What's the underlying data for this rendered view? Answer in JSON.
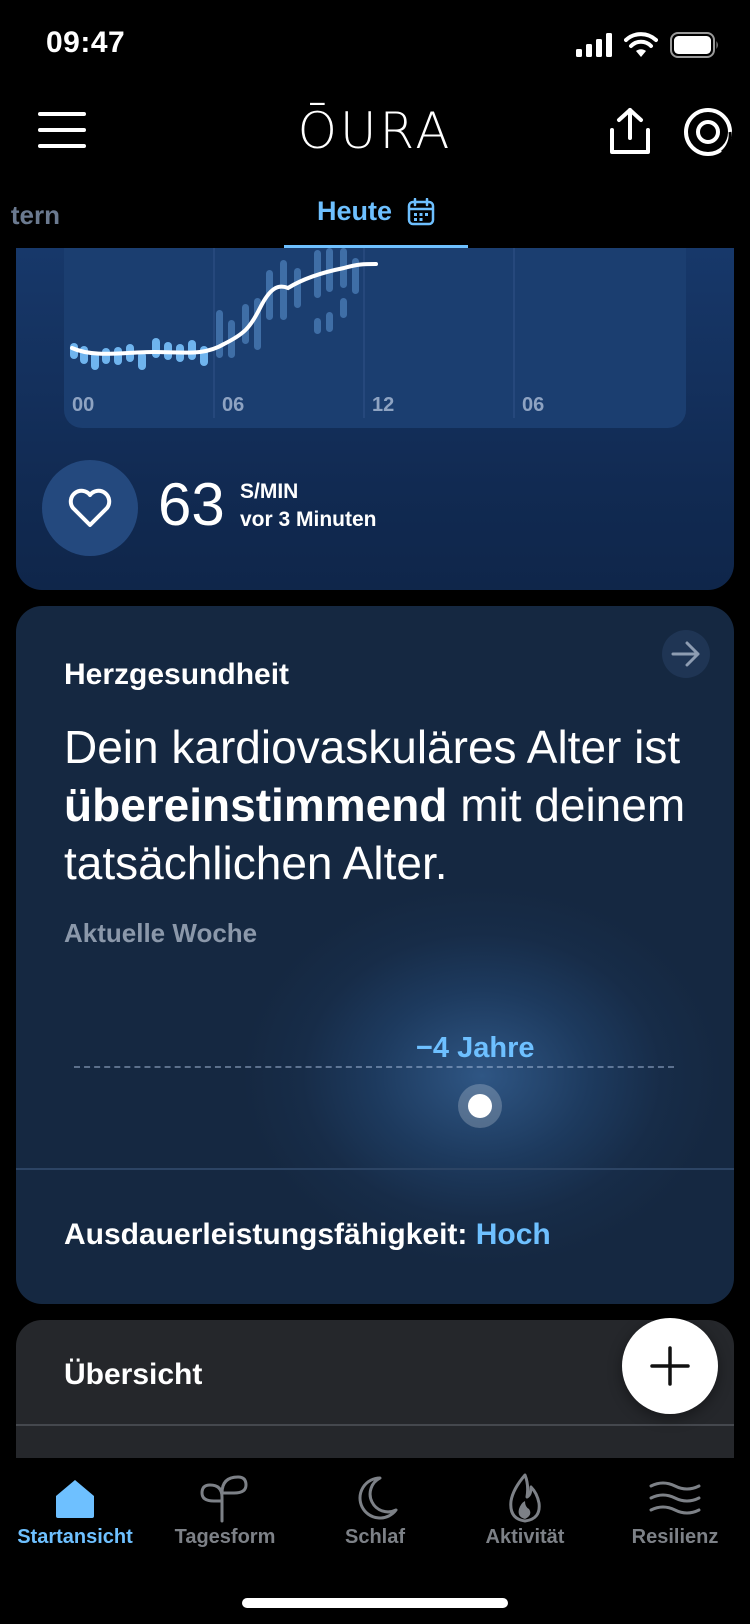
{
  "status_bar": {
    "time": "09:47"
  },
  "header": {
    "brand": "ŌURA"
  },
  "date_tabs": {
    "previous_partial": "tern",
    "today": "Heute"
  },
  "heart_rate": {
    "value": "63",
    "unit": "S/MIN",
    "updated": "vor 3 Minuten",
    "chart_ticks": [
      "00",
      "06",
      "12",
      "06"
    ]
  },
  "heart_health": {
    "title": "Herzgesundheit",
    "headline_before": "Dein kardiovaskuläres Alter ist ",
    "headline_bold": "übereinstimmend",
    "headline_after": " mit deinem tatsächlichen Alter.",
    "period": "Aktuelle Woche",
    "age_offset": "−4 Jahre",
    "capacity_label": "Ausdauerleistungsfähigkeit: ",
    "capacity_value": "Hoch"
  },
  "overview": {
    "title": "Übersicht"
  },
  "bottom_nav": {
    "items": [
      {
        "label": "Startansicht",
        "icon": "home-icon",
        "active": true
      },
      {
        "label": "Tagesform",
        "icon": "sprout-icon",
        "active": false
      },
      {
        "label": "Schlaf",
        "icon": "moon-icon",
        "active": false
      },
      {
        "label": "Aktivität",
        "icon": "flame-icon",
        "active": false
      },
      {
        "label": "Resilienz",
        "icon": "waves-icon",
        "active": false
      }
    ]
  },
  "colors": {
    "accent": "#6ec0ff",
    "card_blue": "#17386a",
    "inactive": "#7d8187"
  }
}
